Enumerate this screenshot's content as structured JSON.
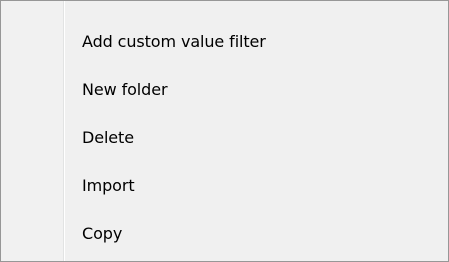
{
  "context_menu": {
    "items": [
      {
        "label": "Add custom value filter"
      },
      {
        "label": "New folder"
      },
      {
        "label": "Delete"
      },
      {
        "label": "Import"
      },
      {
        "label": "Copy"
      }
    ]
  }
}
